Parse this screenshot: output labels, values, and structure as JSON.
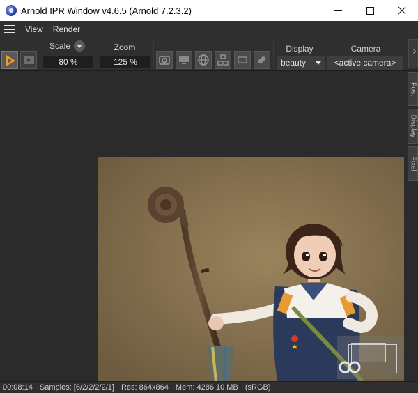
{
  "window": {
    "title": "Arnold IPR Window v4.6.5 (Arnold 7.2.3.2)",
    "controls": {
      "minimize": "—",
      "maximize": "☐",
      "close": "✕"
    }
  },
  "menu": {
    "items": [
      "View",
      "Render"
    ]
  },
  "toolbar": {
    "scale_label": "Scale",
    "scale_value": "80 %",
    "zoom_label": "Zoom",
    "zoom_value": "125 %",
    "display_label": "Display",
    "display_value": "beauty",
    "camera_label": "Camera",
    "camera_value": "<active camera>",
    "accent_color": "#f09a28",
    "icons": [
      "play-render-icon",
      "render-sequence-icon",
      "snapshot-icon",
      "monitor-icon",
      "globe-icon",
      "nodes-icon",
      "region-icon",
      "eraser-icon"
    ]
  },
  "side_tabs": [
    "Post",
    "Display",
    "Pixel"
  ],
  "status": {
    "time": "00:08:14",
    "samples": "Samples: [6/2/2/2/2/1]",
    "res": "Res: 864x864",
    "mem": "Mem: 4286.10 MB",
    "colorspace": "(sRGB)"
  }
}
